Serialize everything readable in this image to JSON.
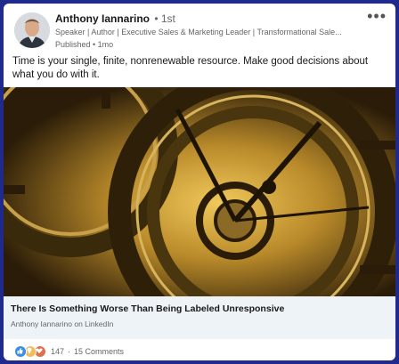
{
  "author": {
    "name": "Anthony Iannarino",
    "degree": "• 1st",
    "headline": "Speaker | Author | Executive Sales & Marketing Leader | Transformational Sale...",
    "published": "Published • 1mo"
  },
  "post": {
    "text": "Time is your single, finite, nonrenewable resource. Make good decisions about what you do with it."
  },
  "article": {
    "title": "There Is Something Worse Than Being Labeled Unresponsive",
    "source": "Anthony Iannarino on LinkedIn"
  },
  "social": {
    "reactions": [
      "like-reaction-icon",
      "insightful-reaction-icon",
      "love-reaction-icon"
    ],
    "reaction_count": "147",
    "separator": "·",
    "comments": "15 Comments"
  },
  "colors": {
    "border": "#1f2a8c",
    "like": "#378fe9",
    "insightful": "#f5bb5c",
    "love": "#df704d"
  }
}
